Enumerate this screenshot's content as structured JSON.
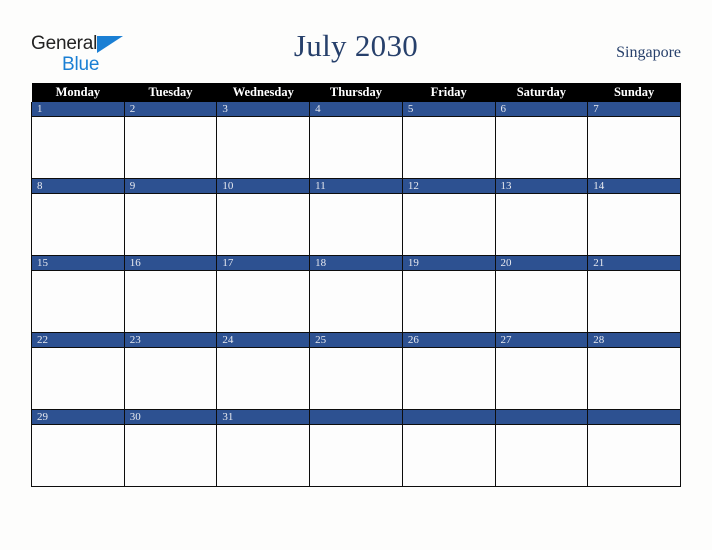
{
  "brand": {
    "name_part1": "General",
    "name_part2": "Blue",
    "flag_icon": "triangle-flag-icon",
    "color_dark": "#232323",
    "color_blue": "#1a7fd4"
  },
  "header": {
    "title": "July 2030",
    "location": "Singapore",
    "title_color": "#27406b"
  },
  "calendar": {
    "month": "July",
    "year": "2030",
    "week_start": "Monday",
    "accent_color": "#2d5191",
    "header_bg": "#000000",
    "weekdays": [
      "Monday",
      "Tuesday",
      "Wednesday",
      "Thursday",
      "Friday",
      "Saturday",
      "Sunday"
    ],
    "weeks": [
      {
        "days": [
          {
            "num": "1"
          },
          {
            "num": "2"
          },
          {
            "num": "3"
          },
          {
            "num": "4"
          },
          {
            "num": "5"
          },
          {
            "num": "6"
          },
          {
            "num": "7"
          }
        ]
      },
      {
        "days": [
          {
            "num": "8"
          },
          {
            "num": "9"
          },
          {
            "num": "10"
          },
          {
            "num": "11"
          },
          {
            "num": "12"
          },
          {
            "num": "13"
          },
          {
            "num": "14"
          }
        ]
      },
      {
        "days": [
          {
            "num": "15"
          },
          {
            "num": "16"
          },
          {
            "num": "17"
          },
          {
            "num": "18"
          },
          {
            "num": "19"
          },
          {
            "num": "20"
          },
          {
            "num": "21"
          }
        ]
      },
      {
        "days": [
          {
            "num": "22"
          },
          {
            "num": "23"
          },
          {
            "num": "24"
          },
          {
            "num": "25"
          },
          {
            "num": "26"
          },
          {
            "num": "27"
          },
          {
            "num": "28"
          }
        ]
      },
      {
        "days": [
          {
            "num": "29"
          },
          {
            "num": "30"
          },
          {
            "num": "31"
          },
          {
            "num": ""
          },
          {
            "num": ""
          },
          {
            "num": ""
          },
          {
            "num": ""
          }
        ]
      }
    ]
  }
}
